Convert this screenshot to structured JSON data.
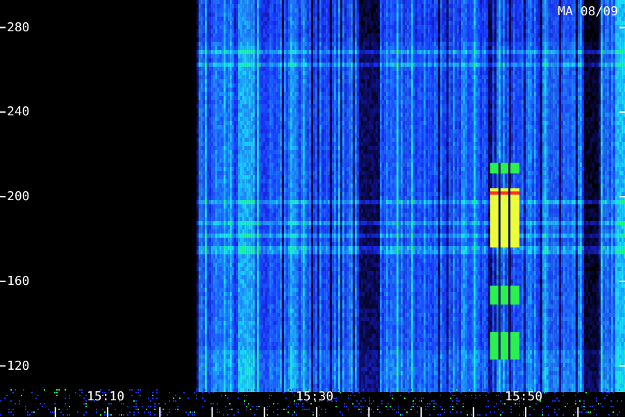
{
  "chart_data": {
    "type": "heatmap",
    "title": "",
    "xlabel": "",
    "ylabel": "",
    "stamp": "MA 08/09",
    "y_ticks": [
      120,
      160,
      200,
      240,
      280
    ],
    "y_tick_labels": [
      "120",
      "160",
      "200",
      "240",
      "280"
    ],
    "ylim": [
      109,
      293
    ],
    "x_tick_labels": [
      "15:10",
      "15:30",
      "15:50"
    ],
    "x_tick_minutes": [
      10,
      30,
      50
    ],
    "xlim_minutes": [
      -0.3,
      59.5
    ],
    "data_start_minute": 18.5,
    "colormap": [
      "#000000",
      "#10107f",
      "#1a33ff",
      "#1f7bff",
      "#19e3ff",
      "#20ff60",
      "#ffff20",
      "#ff3020"
    ],
    "bright_signal": {
      "minute_range": [
        46.6,
        49.4
      ],
      "segments": [
        {
          "y_range": [
            211,
            216
          ],
          "level": "green"
        },
        {
          "y_range": [
            176,
            204
          ],
          "level": "yellow"
        },
        {
          "y_range": [
            201,
            202.5
          ],
          "level": "red"
        },
        {
          "y_range": [
            149,
            158
          ],
          "level": "green"
        },
        {
          "y_range": [
            123,
            136
          ],
          "level": "green"
        }
      ]
    },
    "horizontal_bands": [
      182,
      188,
      198,
      263,
      270,
      176
    ],
    "grid": false,
    "legend": "none"
  }
}
